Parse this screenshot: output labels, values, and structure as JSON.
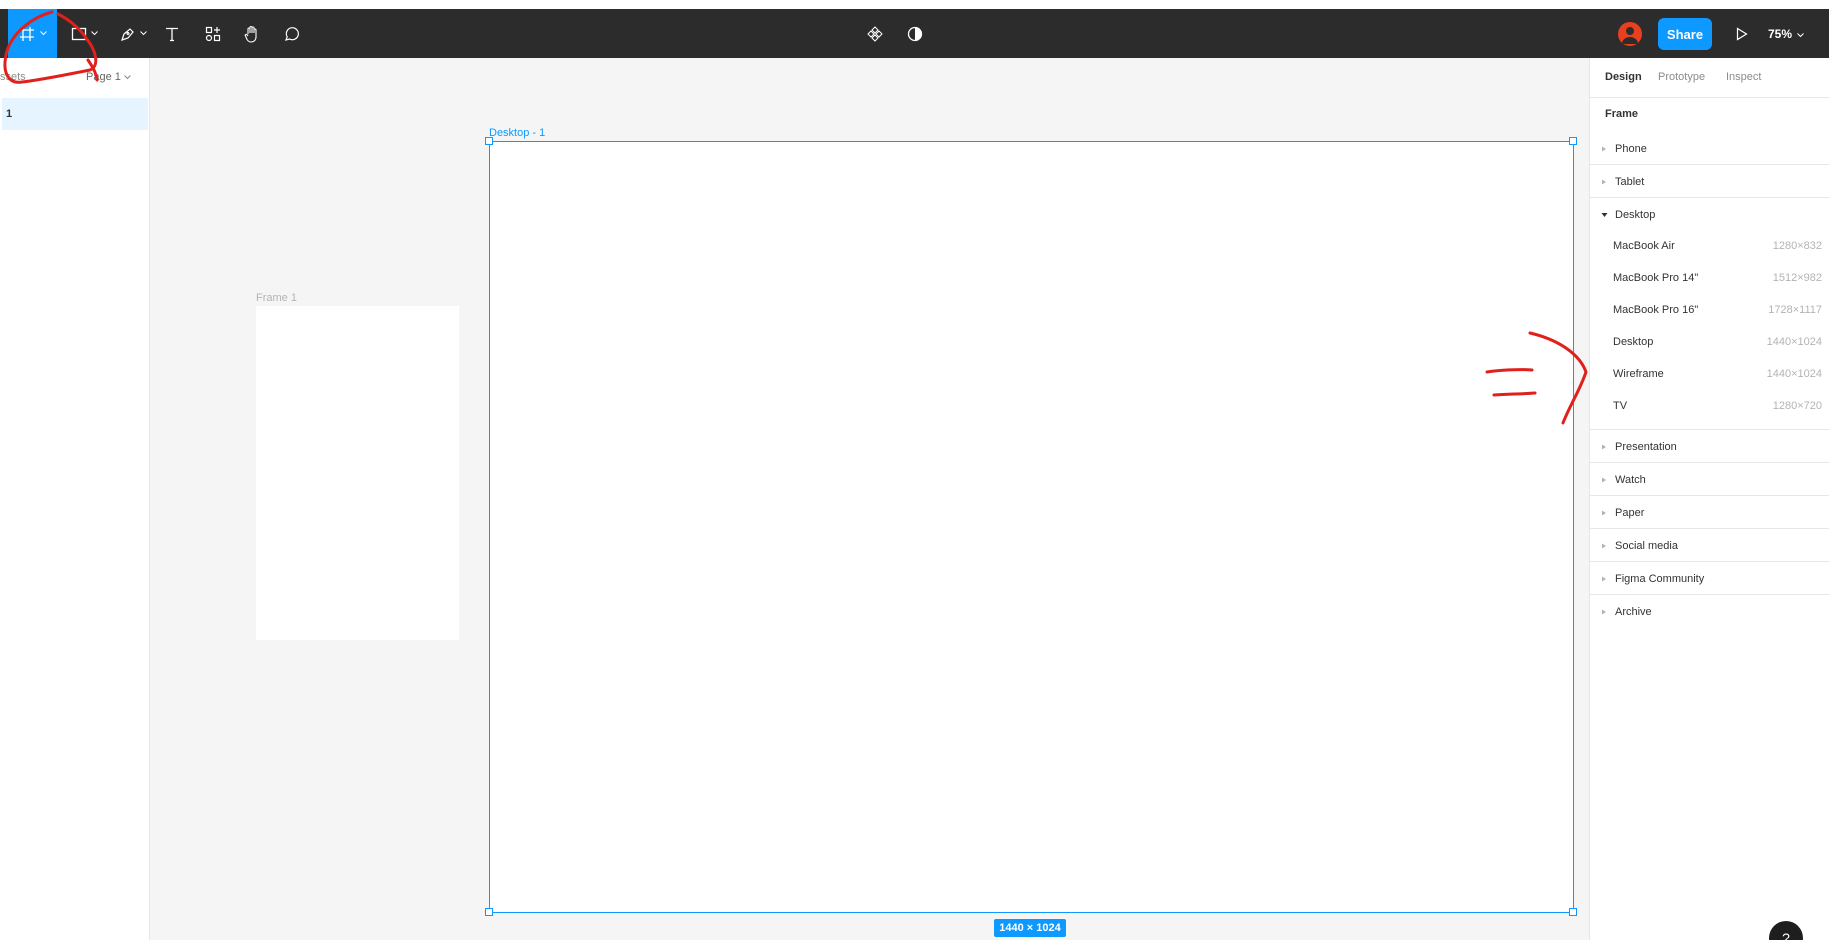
{
  "toolbar": {
    "tools": [
      {
        "name": "frame-tool",
        "icon": "frame-icon",
        "active": true,
        "has_menu": true
      },
      {
        "name": "shape-tool",
        "icon": "rectangle-icon",
        "active": false,
        "has_menu": true
      },
      {
        "name": "pen-tool",
        "icon": "pen-icon",
        "active": false,
        "has_menu": true
      },
      {
        "name": "text-tool",
        "icon": "text-icon",
        "active": false,
        "has_menu": false
      },
      {
        "name": "resources-tool",
        "icon": "resources-icon",
        "active": false,
        "has_menu": false
      },
      {
        "name": "hand-tool",
        "icon": "hand-icon",
        "active": false,
        "has_menu": false
      },
      {
        "name": "comment-tool",
        "icon": "comment-icon",
        "active": false,
        "has_menu": false
      }
    ],
    "center_icons": [
      "components-icon",
      "contrast-icon"
    ],
    "share_label": "Share",
    "zoom_label": "75%"
  },
  "left_panel": {
    "assets_label": "ssets",
    "page_label": "Page 1",
    "layer_label": "1"
  },
  "canvas": {
    "frame1_label": "Frame 1",
    "desktop_label": "Desktop - 1",
    "size_badge": "1440 × 1024"
  },
  "right_panel": {
    "tabs": [
      "Design",
      "Prototype",
      "Inspect"
    ],
    "section_title": "Frame",
    "groups_before": [
      {
        "label": "Phone",
        "expanded": false
      },
      {
        "label": "Tablet",
        "expanded": false
      },
      {
        "label": "Desktop",
        "expanded": true
      }
    ],
    "desktop_items": [
      {
        "name": "MacBook Air",
        "size": "1280×832"
      },
      {
        "name": "MacBook Pro 14\"",
        "size": "1512×982"
      },
      {
        "name": "MacBook Pro 16\"",
        "size": "1728×1117"
      },
      {
        "name": "Desktop",
        "size": "1440×1024"
      },
      {
        "name": "Wireframe",
        "size": "1440×1024"
      },
      {
        "name": "TV",
        "size": "1280×720"
      }
    ],
    "groups_after": [
      {
        "label": "Presentation"
      },
      {
        "label": "Watch"
      },
      {
        "label": "Paper"
      },
      {
        "label": "Social media"
      },
      {
        "label": "Figma Community"
      },
      {
        "label": "Archive"
      }
    ]
  },
  "help_label": "?",
  "colors": {
    "accent": "#0d99ff",
    "toolbar_bg": "#2c2c2c",
    "canvas_bg": "#f5f5f5",
    "annotation": "#e0201b"
  }
}
